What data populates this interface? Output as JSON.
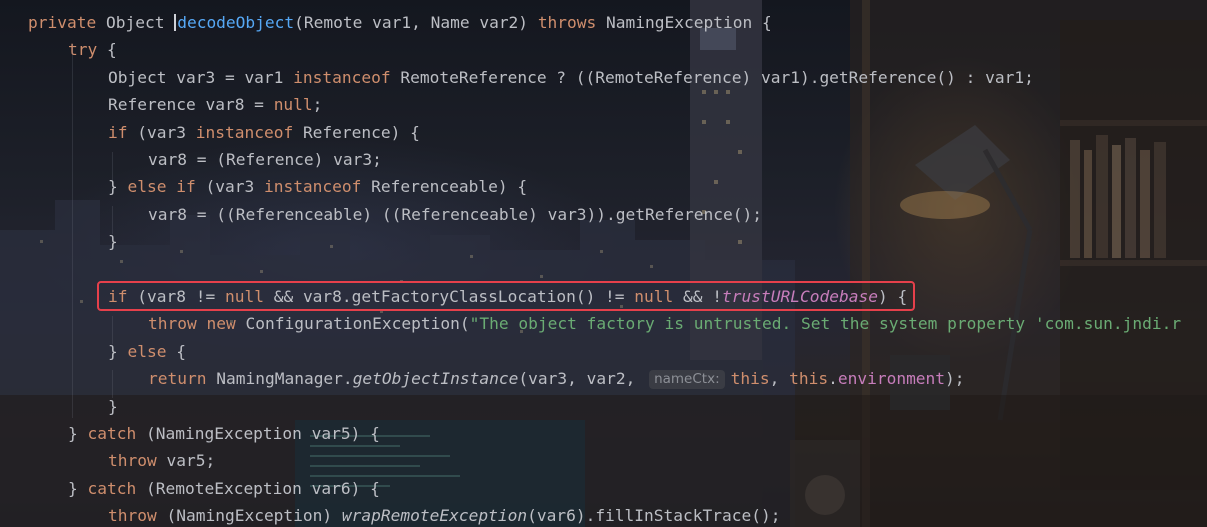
{
  "editor": {
    "parameter_hint": "nameCtx:",
    "lines": [
      {
        "indent": 0,
        "tokens": [
          {
            "t": "private ",
            "c": "kw"
          },
          {
            "t": "Object ",
            "c": ""
          },
          {
            "t": "decodeObject",
            "c": "fn"
          },
          {
            "t": "(Remote var1, Name var2) ",
            "c": ""
          },
          {
            "t": "throws ",
            "c": "kw"
          },
          {
            "t": "NamingException {",
            "c": ""
          }
        ]
      },
      {
        "indent": 1,
        "tokens": [
          {
            "t": "try",
            "c": "kw"
          },
          {
            "t": " {",
            "c": ""
          }
        ]
      },
      {
        "indent": 2,
        "tokens": [
          {
            "t": "Object var3 = var1 ",
            "c": ""
          },
          {
            "t": "instanceof ",
            "c": "kw"
          },
          {
            "t": "RemoteReference ? ((RemoteReference) var1).getReference() : var1;",
            "c": ""
          }
        ]
      },
      {
        "indent": 2,
        "tokens": [
          {
            "t": "Reference var8 = ",
            "c": ""
          },
          {
            "t": "null",
            "c": "kw"
          },
          {
            "t": ";",
            "c": ""
          }
        ]
      },
      {
        "indent": 2,
        "tokens": [
          {
            "t": "if ",
            "c": "kw"
          },
          {
            "t": "(var3 ",
            "c": ""
          },
          {
            "t": "instanceof ",
            "c": "kw"
          },
          {
            "t": "Reference) {",
            "c": ""
          }
        ]
      },
      {
        "indent": 3,
        "tokens": [
          {
            "t": "var8 = (Reference) var3;",
            "c": ""
          }
        ]
      },
      {
        "indent": 2,
        "tokens": [
          {
            "t": "} ",
            "c": ""
          },
          {
            "t": "else if ",
            "c": "kw"
          },
          {
            "t": "(var3 ",
            "c": ""
          },
          {
            "t": "instanceof ",
            "c": "kw"
          },
          {
            "t": "Referenceable) {",
            "c": ""
          }
        ]
      },
      {
        "indent": 3,
        "tokens": [
          {
            "t": "var8 = ((Referenceable) ((Referenceable) var3)).getReference();",
            "c": ""
          }
        ]
      },
      {
        "indent": 2,
        "tokens": [
          {
            "t": "}",
            "c": ""
          }
        ]
      },
      {
        "indent": 2,
        "tokens": []
      },
      {
        "indent": 2,
        "tokens": [
          {
            "t": "if ",
            "c": "kw"
          },
          {
            "t": "(var8 != ",
            "c": ""
          },
          {
            "t": "null ",
            "c": "kw"
          },
          {
            "t": "&& var8.getFactoryClassLocation() != ",
            "c": ""
          },
          {
            "t": "null ",
            "c": "kw"
          },
          {
            "t": "&& !",
            "c": ""
          },
          {
            "t": "trustURLCodebase",
            "c": "sfield"
          },
          {
            "t": ") {",
            "c": ""
          }
        ]
      },
      {
        "indent": 3,
        "tokens": [
          {
            "t": "throw new ",
            "c": "kw"
          },
          {
            "t": "ConfigurationException(",
            "c": ""
          },
          {
            "t": "\"The object factory is untrusted. Set the system property 'com.sun.jndi.r",
            "c": "st"
          }
        ]
      },
      {
        "indent": 2,
        "tokens": [
          {
            "t": "} ",
            "c": ""
          },
          {
            "t": "else ",
            "c": "kw"
          },
          {
            "t": "{",
            "c": ""
          }
        ]
      },
      {
        "indent": 3,
        "tokens": [
          {
            "t": "return ",
            "c": "kw"
          },
          {
            "t": "NamingManager.",
            "c": ""
          },
          {
            "t": "getObjectInstance",
            "c": "it"
          },
          {
            "t": "(var3, var2, ",
            "c": ""
          },
          {
            "t": "nameCtx:",
            "c": "hint"
          },
          {
            "t": "this",
            "c": "kw"
          },
          {
            "t": ", ",
            "c": ""
          },
          {
            "t": "this",
            "c": "kw"
          },
          {
            "t": ".",
            "c": ""
          },
          {
            "t": "environment",
            "c": "field"
          },
          {
            "t": ");",
            "c": ""
          }
        ]
      },
      {
        "indent": 2,
        "tokens": [
          {
            "t": "}",
            "c": ""
          }
        ]
      },
      {
        "indent": 1,
        "tokens": [
          {
            "t": "} ",
            "c": ""
          },
          {
            "t": "catch ",
            "c": "kw"
          },
          {
            "t": "(NamingException var5) {",
            "c": ""
          }
        ]
      },
      {
        "indent": 2,
        "tokens": [
          {
            "t": "throw ",
            "c": "kw"
          },
          {
            "t": "var5;",
            "c": ""
          }
        ]
      },
      {
        "indent": 1,
        "tokens": [
          {
            "t": "} ",
            "c": ""
          },
          {
            "t": "catch ",
            "c": "kw"
          },
          {
            "t": "(RemoteException var6) {",
            "c": ""
          }
        ]
      },
      {
        "indent": 2,
        "tokens": [
          {
            "t": "throw ",
            "c": "kw"
          },
          {
            "t": "(NamingException) ",
            "c": ""
          },
          {
            "t": "wrapRemoteException",
            "c": "it"
          },
          {
            "t": "(var6).fillInStackTrace();",
            "c": ""
          }
        ]
      }
    ]
  },
  "theme": {
    "keyword": "#cf8e6d",
    "method_declaration": "#56a8f5",
    "string": "#6aab73",
    "field": "#c77dbb",
    "default_text": "#bcbec4",
    "highlight_border": "#e6404b"
  }
}
